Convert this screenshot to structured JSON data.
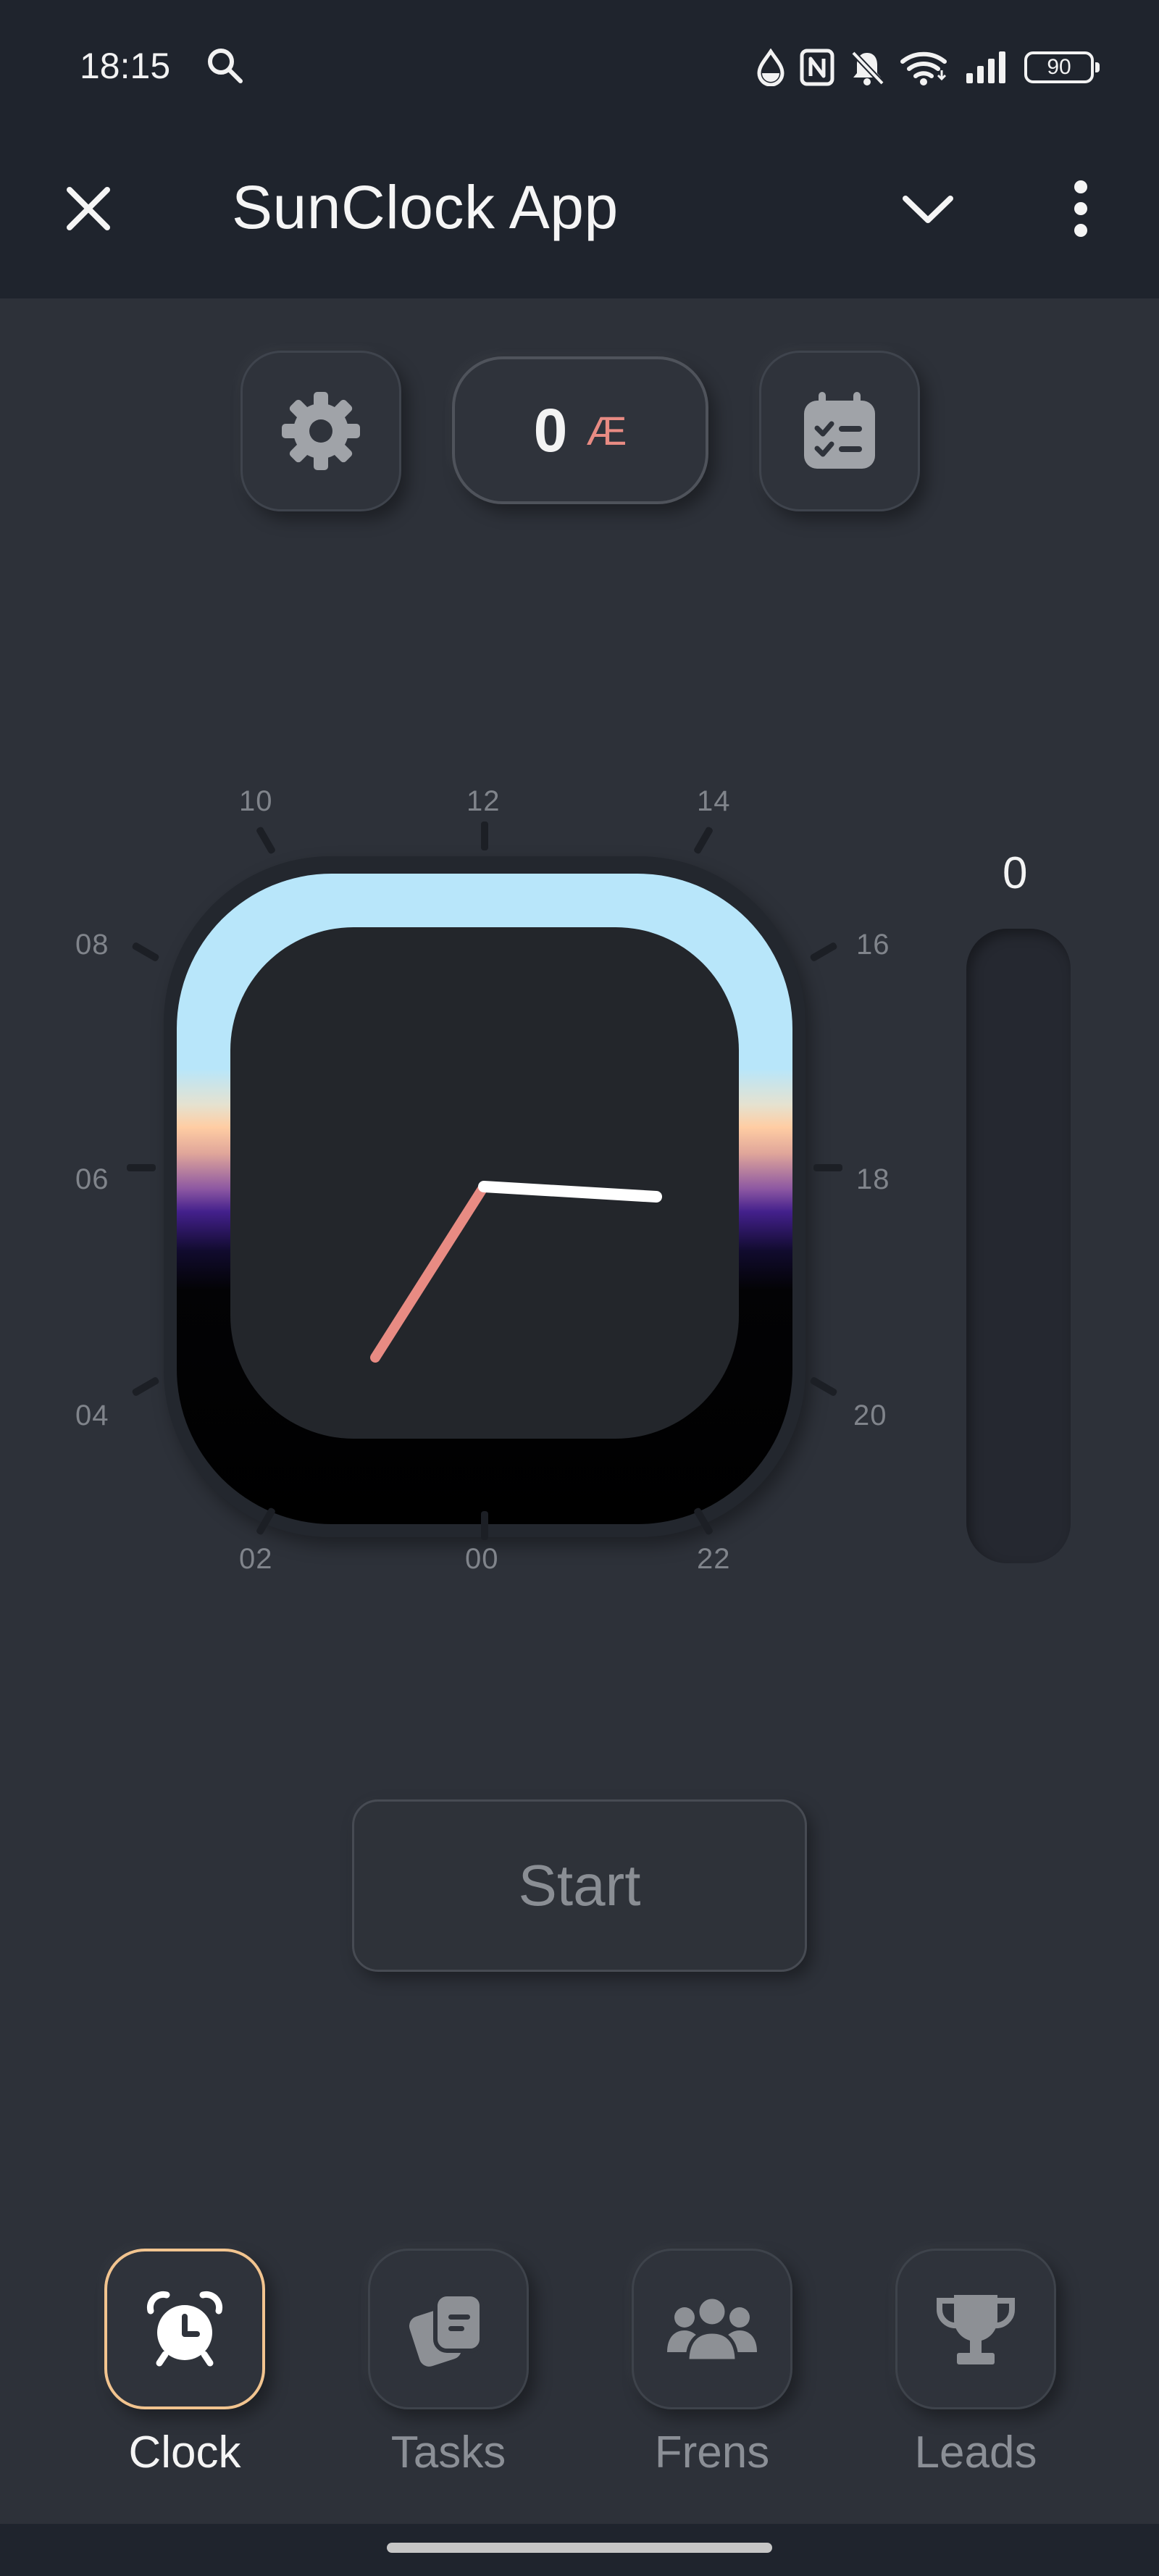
{
  "status_bar": {
    "time": "18:15",
    "battery": "90",
    "icons": [
      "search-icon",
      "drop-icon",
      "nfc-icon",
      "bell-off-icon",
      "wifi-icon",
      "signal-icon",
      "battery-icon"
    ]
  },
  "app_bar": {
    "title": "SunClock App",
    "icons": [
      "close-icon",
      "chevron-down-icon",
      "more-vertical-icon"
    ]
  },
  "top_controls": {
    "balance_value": "0",
    "balance_unit": "Æ",
    "icons": [
      "gear-icon",
      "calendar-checklist-icon"
    ]
  },
  "clock": {
    "hour_labels": [
      "00",
      "02",
      "04",
      "06",
      "08",
      "10",
      "12",
      "14",
      "16",
      "18",
      "20",
      "22"
    ],
    "colors": {
      "minute_hand": "#e88b83",
      "hour_hand": "#ffffff",
      "sky_day": "#b8e6fa",
      "sunset": "#ffcda3",
      "dusk": "#43208c",
      "night": "#000000"
    }
  },
  "meter": {
    "value": "0",
    "level": 0
  },
  "start_button": {
    "label": "Start"
  },
  "bottom_nav": {
    "items": [
      {
        "label": "Clock",
        "icon": "alarm-clock-icon",
        "active": true
      },
      {
        "label": "Tasks",
        "icon": "tasks-cards-icon",
        "active": false
      },
      {
        "label": "Frens",
        "icon": "group-icon",
        "active": false
      },
      {
        "label": "Leads",
        "icon": "trophy-icon",
        "active": false
      }
    ],
    "active_color": "#f2c48f"
  }
}
